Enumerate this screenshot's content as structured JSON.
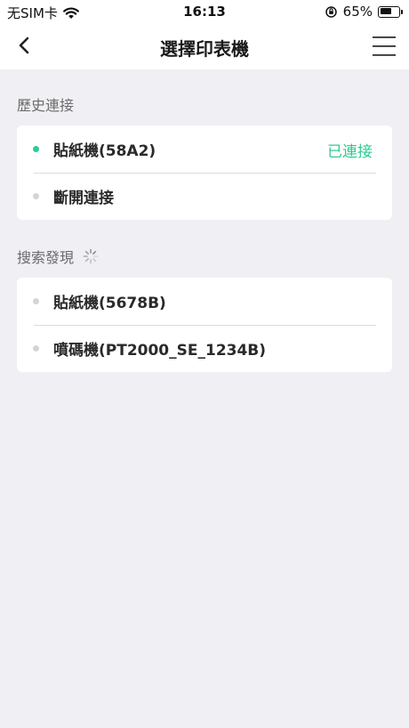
{
  "status_bar": {
    "carrier": "无SIM卡",
    "time": "16:13",
    "battery_percent": "65%",
    "battery_level": 0.65
  },
  "nav": {
    "title": "選擇印表機"
  },
  "history": {
    "header": "歷史連接",
    "items": [
      {
        "label": "貼紙機(58A2)",
        "status": "已連接",
        "dot_color": "#2ecb92"
      },
      {
        "label": "斷開連接",
        "dot_color": "#d4d4d4"
      }
    ]
  },
  "search": {
    "header": "搜索發現",
    "items": [
      {
        "label": "貼紙機(5678B)",
        "dot_color": "#d4d4d4"
      },
      {
        "label": "噴碼機(PT2000_SE_1234B)",
        "dot_color": "#d4d4d4"
      }
    ]
  },
  "colors": {
    "accent": "#2ecb92",
    "background": "#efeff4"
  }
}
